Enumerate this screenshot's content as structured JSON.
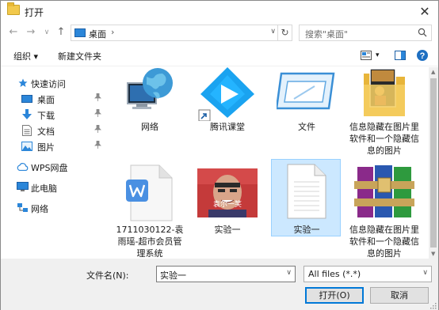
{
  "window": {
    "title": "打开",
    "close_glyph": "✕"
  },
  "nav": {
    "back_glyph": "←",
    "forward_glyph": "→",
    "recent_glyph": "∨",
    "up_glyph": "↑"
  },
  "address": {
    "location": "桌面",
    "separator": "›",
    "dropdown_glyph": "∨",
    "refresh_glyph": "↻"
  },
  "search": {
    "placeholder": "搜索\"桌面\""
  },
  "toolbar": {
    "organize_label": "组织",
    "organize_dropdown": "▾",
    "new_folder_label": "新建文件夹",
    "view_dropdown": "▾",
    "help_glyph": "?"
  },
  "sidebar": {
    "items": [
      {
        "label": "快速访问",
        "icon": "star-icon"
      },
      {
        "label": "桌面",
        "icon": "desktop-icon",
        "pinned": true
      },
      {
        "label": "下载",
        "icon": "download-icon",
        "pinned": true
      },
      {
        "label": "文档",
        "icon": "document-icon",
        "pinned": true
      },
      {
        "label": "图片",
        "icon": "picture-icon",
        "pinned": true
      },
      {
        "label": "WPS网盘",
        "icon": "cloud-icon"
      },
      {
        "label": "此电脑",
        "icon": "computer-icon"
      },
      {
        "label": "网络",
        "icon": "network-icon"
      }
    ],
    "pin_glyph": "📌"
  },
  "files": [
    {
      "name": "网络",
      "icon": "network-globe-icon"
    },
    {
      "name": "腾讯课堂",
      "icon": "tencent-classroom-icon"
    },
    {
      "name": "文件",
      "icon": "shortcut-window-icon"
    },
    {
      "name": "信息隐藏在图片里软件和一个隐藏信息的图片",
      "icon": "folder-icon"
    },
    {
      "name": "1711030122-袁雨瑶-超市会员管理系统",
      "icon": "wps-doc-icon"
    },
    {
      "name": "实验一",
      "icon": "photo-thumbnail-icon",
      "watermark": "袁尔一笑"
    },
    {
      "name": "实验一",
      "icon": "blank-file-icon",
      "selected": true
    },
    {
      "name": "信息隐藏在图片里软件和一个隐藏信息的图片",
      "icon": "winrar-archive-icon"
    }
  ],
  "bottom": {
    "filename_label": "文件名(N):",
    "filename_value": "实验一",
    "filename_dropdown": "∨",
    "filetype_value": "All files (*.*)",
    "filetype_dropdown": "∨",
    "open_label": "打开(O)",
    "cancel_label": "取消"
  },
  "colors": {
    "accent": "#0078d7",
    "selection_bg": "#cce8ff",
    "selection_border": "#99d1ff",
    "footer_bg": "#f0f0f0"
  }
}
